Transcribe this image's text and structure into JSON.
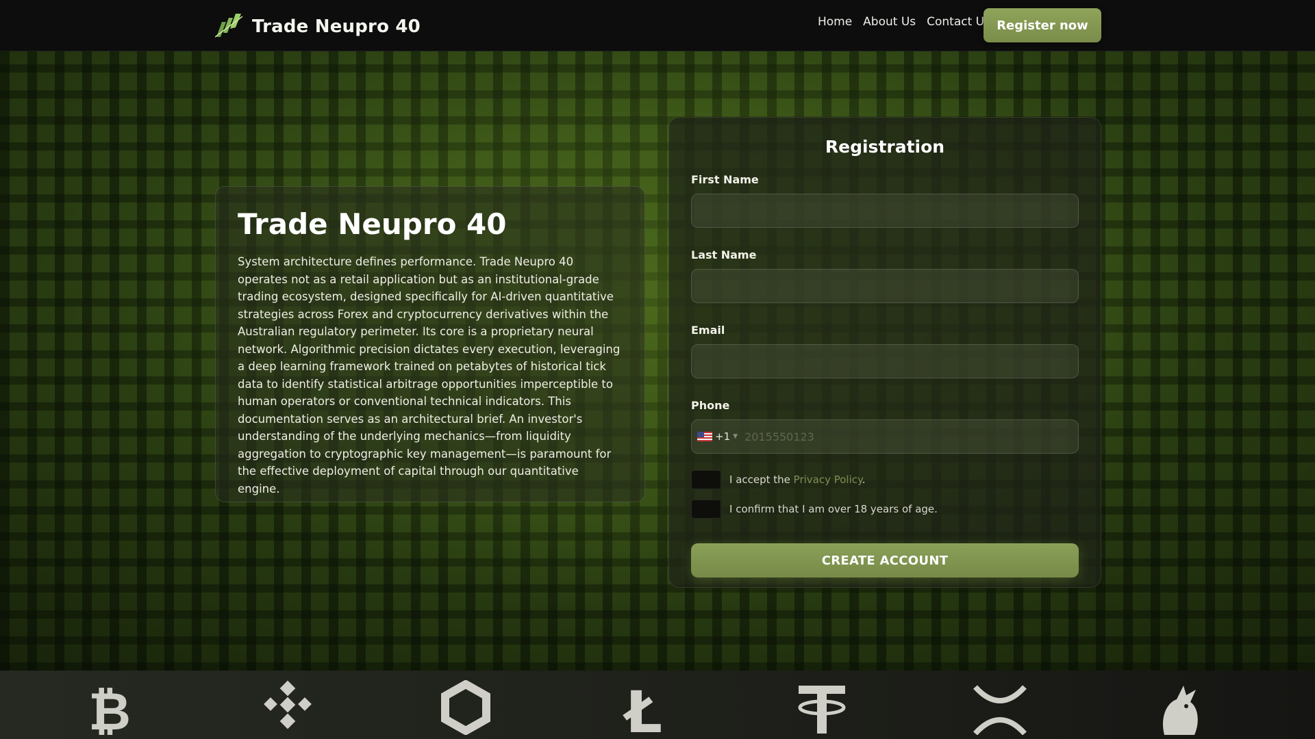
{
  "header": {
    "brand": "Trade Neupro 40",
    "nav": [
      "Home",
      "About Us",
      "Contact Us"
    ],
    "register_label": "Register now"
  },
  "info": {
    "title": "Trade Neupro 40",
    "body": "System architecture defines performance. Trade Neupro 40 operates not as a retail application but as an institutional-grade trading ecosystem, designed specifically for AI-driven quantitative strategies across Forex and cryptocurrency derivatives within the Australian regulatory perimeter. Its core is a proprietary neural network. Algorithmic precision dictates every execution, leveraging a deep learning framework trained on petabytes of historical tick data to identify statistical arbitrage opportunities imperceptible to human operators or conventional technical indicators. This documentation serves as an architectural brief. An investor's understanding of the underlying mechanics—from liquidity aggregation to cryptographic key management—is paramount for the effective deployment of capital through our quantitative engine."
  },
  "form": {
    "title": "Registration",
    "first_name_label": "First Name",
    "last_name_label": "Last Name",
    "email_label": "Email",
    "phone_label": "Phone",
    "dial_code": "+1",
    "phone_placeholder": "2015550123",
    "privacy_prefix": "I accept the ",
    "privacy_link": "Privacy Policy",
    "privacy_suffix": ".",
    "age_text": "I confirm that I am over 18 years of age.",
    "submit_label": "CREATE ACCOUNT"
  },
  "crypto_icons": [
    "bitcoin-icon",
    "binance-icon",
    "chainlink-icon",
    "litecoin-icon",
    "tether-icon",
    "xrp-icon",
    "uniswap-icon"
  ],
  "colors": {
    "accent": "#8aa058",
    "header_bg": "#0d0d0d",
    "link": "#7f8f54"
  }
}
